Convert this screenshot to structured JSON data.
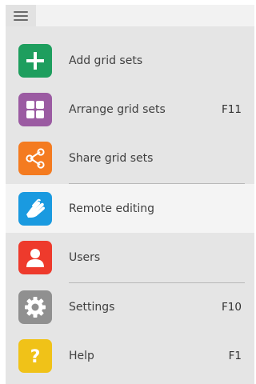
{
  "menu": {
    "items": [
      {
        "id": "add",
        "label": "Add grid sets",
        "shortcut": "",
        "icon": "plus-icon",
        "color": "#1e9e5e"
      },
      {
        "id": "arrange",
        "label": "Arrange grid sets",
        "shortcut": "F11",
        "icon": "grid-icon",
        "color": "#9b5ba2"
      },
      {
        "id": "share",
        "label": "Share grid sets",
        "shortcut": "",
        "icon": "share-icon",
        "color": "#f47b20"
      },
      {
        "id": "remote",
        "label": "Remote editing",
        "shortcut": "",
        "icon": "hand-icon",
        "color": "#1a9ae0"
      },
      {
        "id": "users",
        "label": "Users",
        "shortcut": "",
        "icon": "user-icon",
        "color": "#ee3a2c"
      },
      {
        "id": "settings",
        "label": "Settings",
        "shortcut": "F10",
        "icon": "gear-icon",
        "color": "#909090"
      },
      {
        "id": "help",
        "label": "Help",
        "shortcut": "F1",
        "icon": "question-icon",
        "color": "#f0c218"
      }
    ],
    "highlighted": "Remote editing"
  },
  "topbar": {
    "menu_icon": "hamburger-menu-icon"
  }
}
